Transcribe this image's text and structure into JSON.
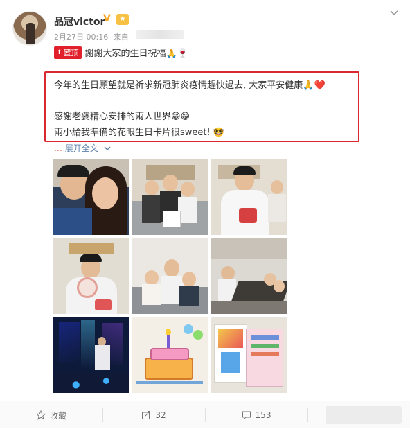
{
  "post": {
    "author": "品冠victor",
    "verified_mark": "V",
    "date": "2月27日 00:16",
    "source_prefix": "来自",
    "pin_label": "置顶",
    "headline": "謝謝大家的生日祝福🙏🍷",
    "body_line1": "今年的生日願望就是祈求新冠肺炎疫情趕快過去, 大家平安健康🙏❤️",
    "body_line2": "感謝老婆精心安排的兩人世界😁😁",
    "body_line3": "兩小給我準備的花眼生日卡片很sweet! 🤓",
    "expand_dots": "…",
    "expand_label": "展开全文"
  },
  "photos": [
    "couple-selfie",
    "family-with-cake",
    "man-with-cake",
    "man-holding-plate",
    "family-on-sofa",
    "dining-room",
    "party-lights",
    "cake-drawing",
    "birthday-cards"
  ],
  "footer": {
    "favorite_label": "收藏",
    "repost_count": "32",
    "comment_count": "153"
  },
  "colors": {
    "pin_red": "#e0212b",
    "highlight_border": "#d9282f",
    "link": "#eb7350",
    "badge": "#f5a623"
  }
}
